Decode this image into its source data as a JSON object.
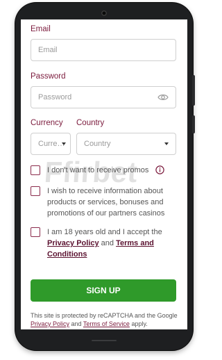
{
  "form": {
    "email_label": "Email",
    "email_placeholder": "Email",
    "password_label": "Password",
    "password_placeholder": "Password",
    "currency_label": "Currency",
    "currency_value": "Curre…",
    "country_label": "Country",
    "country_value": "Country",
    "promos_text": "I don't want to receive promos",
    "info_text": "I wish to receive information about products or services, bonuses and promotions of our partners casinos",
    "age_text": "I am 18 years old and I accept the",
    "privacy_link": "Privacy Policy",
    "and_text": "and",
    "terms_link": "Terms and Conditions",
    "signup_label": "SIGN UP",
    "captcha_text_1": "This site is protected by reCAPTCHA and the Google",
    "captcha_privacy": "Privacy Policy",
    "captcha_and": "and",
    "captcha_terms": "Terms of Service",
    "captcha_apply": "apply."
  },
  "watermark": "Ffirbet",
  "colors": {
    "label": "#7b1a3c",
    "signup_bg": "#2f9a2a",
    "checkbox_border": "#8a2a4b"
  },
  "icons": {
    "password_toggle": "eye-icon",
    "promos_info": "info-icon"
  }
}
